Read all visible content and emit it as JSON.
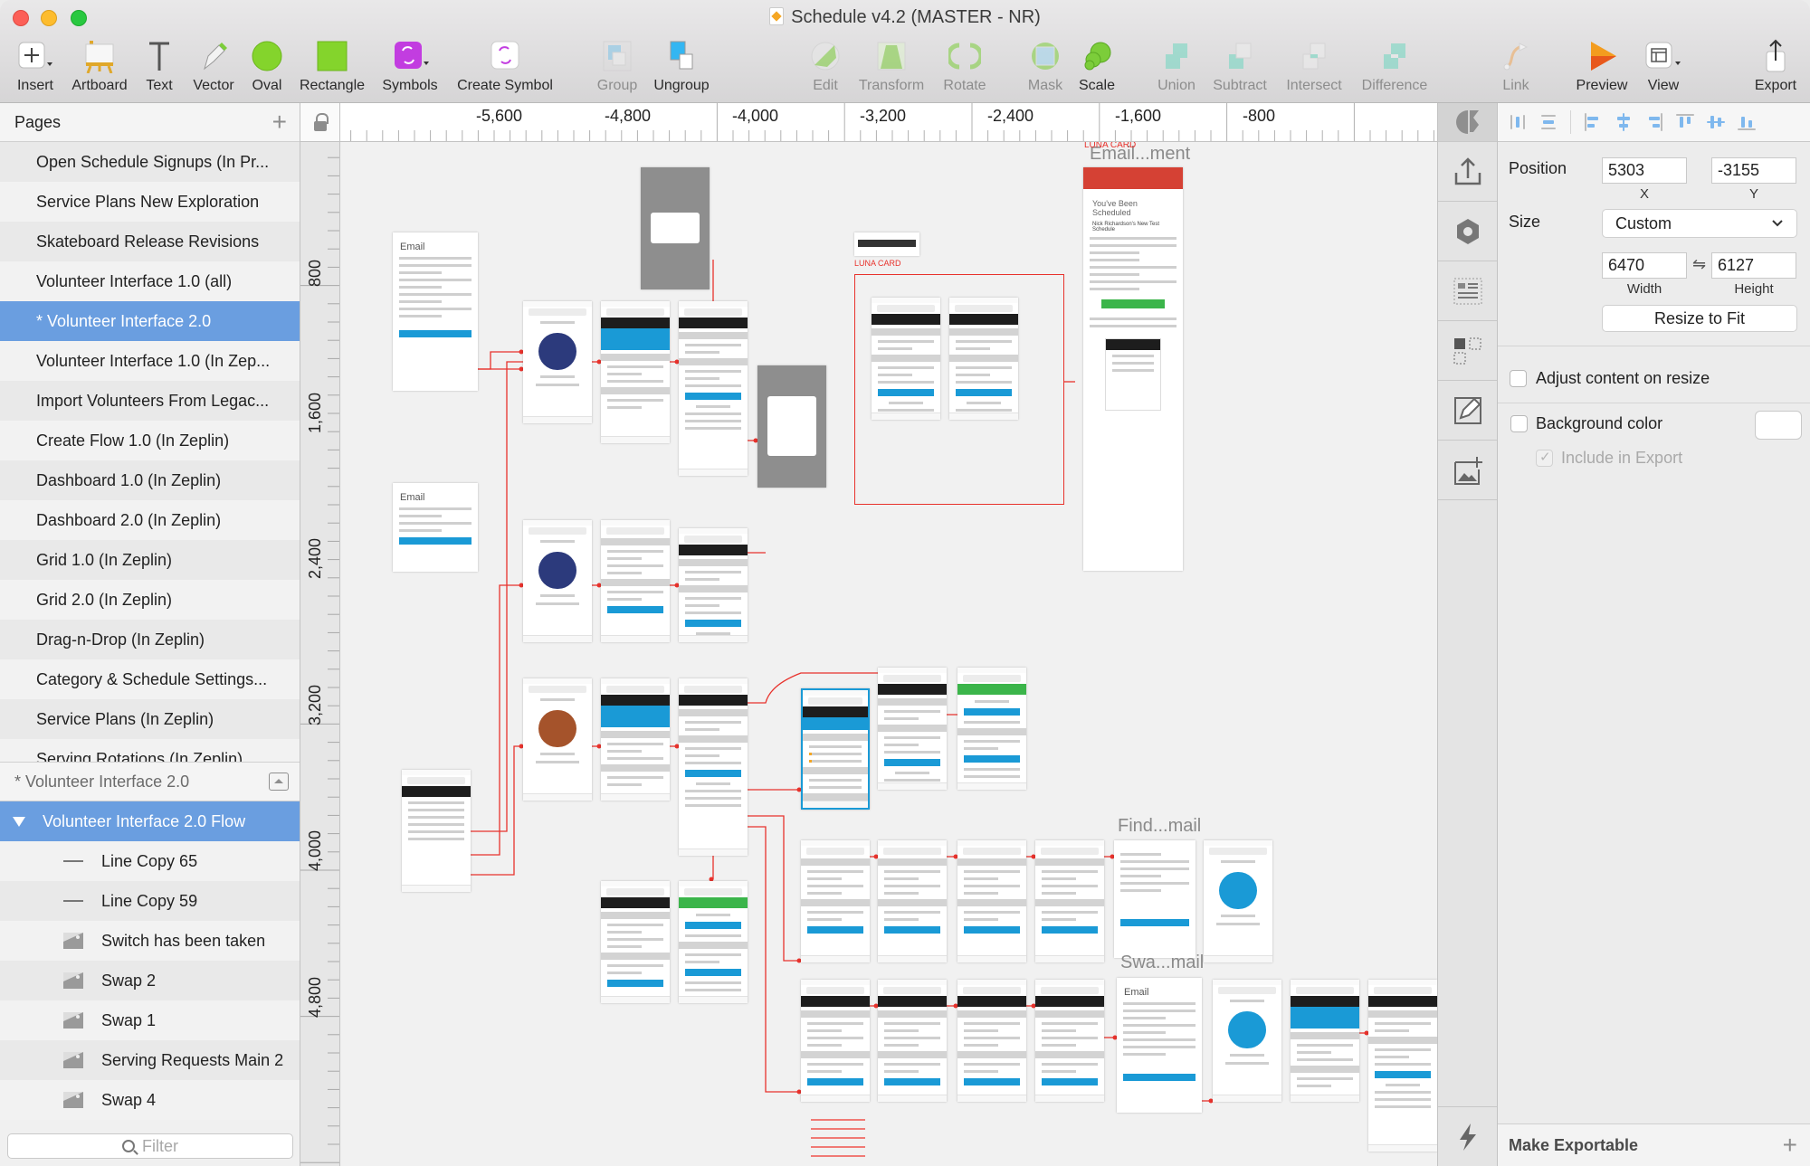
{
  "window": {
    "title": "Schedule v4.2 (MASTER - NR)"
  },
  "toolbar": {
    "insert": "Insert",
    "artboard": "Artboard",
    "text": "Text",
    "vector": "Vector",
    "oval": "Oval",
    "rectangle": "Rectangle",
    "symbols": "Symbols",
    "create_symbol": "Create Symbol",
    "group": "Group",
    "ungroup": "Ungroup",
    "edit": "Edit",
    "transform": "Transform",
    "rotate": "Rotate",
    "mask": "Mask",
    "scale": "Scale",
    "union": "Union",
    "subtract": "Subtract",
    "intersect": "Intersect",
    "difference": "Difference",
    "link": "Link",
    "preview": "Preview",
    "view": "View",
    "export": "Export"
  },
  "sidebar": {
    "pages_header": "Pages",
    "pages": [
      {
        "label": "Open Schedule Signups (In Pr..."
      },
      {
        "label": "Service Plans New Exploration"
      },
      {
        "label": "Skateboard Release Revisions"
      },
      {
        "label": "Volunteer Interface 1.0 (all)"
      },
      {
        "label": "* Volunteer Interface 2.0",
        "selected": true
      },
      {
        "label": "Volunteer Interface 1.0 (In Zep..."
      },
      {
        "label": "Import Volunteers From Legac..."
      },
      {
        "label": "Create Flow 1.0 (In Zeplin)"
      },
      {
        "label": "Dashboard 1.0 (In Zeplin)"
      },
      {
        "label": "Dashboard 2.0 (In Zeplin)"
      },
      {
        "label": "Grid 1.0 (In Zeplin)"
      },
      {
        "label": "Grid 2.0 (In Zeplin)"
      },
      {
        "label": "Drag-n-Drop (In Zeplin)"
      },
      {
        "label": "Category & Schedule Settings..."
      },
      {
        "label": "Service Plans (In Zeplin)"
      },
      {
        "label": "Serving Rotations (In Zeplin)"
      }
    ],
    "current_page": "* Volunteer Interface 2.0",
    "layers": [
      {
        "label": "Volunteer Interface 2.0 Flow",
        "type": "group",
        "expanded": true
      },
      {
        "label": "Line Copy 65",
        "type": "line"
      },
      {
        "label": "Line Copy 59",
        "type": "line"
      },
      {
        "label": "Switch has been taken",
        "type": "image"
      },
      {
        "label": "Swap 2",
        "type": "image"
      },
      {
        "label": "Swap 1",
        "type": "image"
      },
      {
        "label": "Serving Requests Main 2",
        "type": "image"
      },
      {
        "label": "Swap 4",
        "type": "image"
      }
    ],
    "filter_placeholder": "Filter"
  },
  "rulers": {
    "horizontal": [
      "-5,600",
      "-4,800",
      "-4,000",
      "-3,200",
      "-2,400",
      "-1,600",
      "-800"
    ],
    "vertical": [
      "800",
      "1,600",
      "2,400",
      "3,200",
      "4,000",
      "4,800"
    ]
  },
  "canvas": {
    "email_title_1": "Email",
    "email_title_2": "Email",
    "email_title_3": "Email",
    "artboard_label_email_ment": "Email...ment",
    "artboard_label_find_mail": "Find...mail",
    "artboard_label_swa_mail": "Swa...mail",
    "luna_card_1": "LUNA CARD",
    "luna_card_2": "LUNA CARD",
    "gmail_heading": "You've Been Scheduled",
    "gmail_subheading": "Nick Richardson's New Test Schedule",
    "accent_red": "#e8322c",
    "accent_blue": "#1a9ad6"
  },
  "inspector": {
    "position_label": "Position",
    "x_value": "5303",
    "y_value": "-3155",
    "x_label": "X",
    "y_label": "Y",
    "size_label": "Size",
    "size_preset": "Custom",
    "width_value": "6470",
    "height_value": "6127",
    "width_label": "Width",
    "height_label": "Height",
    "resize_to_fit": "Resize to Fit",
    "adjust_content": "Adjust content on resize",
    "adjust_content_checked": false,
    "background_color": "Background color",
    "background_color_checked": false,
    "include_in_export": "Include in Export",
    "include_in_export_checked": true,
    "make_exportable": "Make Exportable"
  }
}
